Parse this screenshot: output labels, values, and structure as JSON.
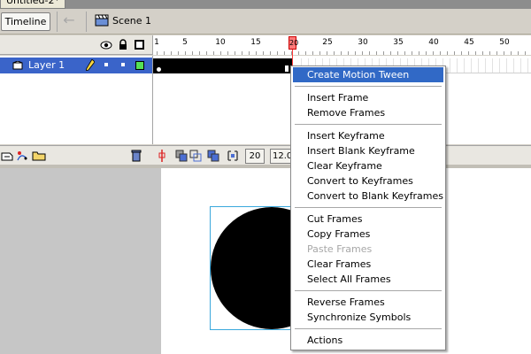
{
  "document": {
    "tab_title": "Untitled-2*"
  },
  "toolbar": {
    "timeline_label": "Timeline",
    "scene_label": "Scene 1"
  },
  "timeline": {
    "ruler_labels": [
      "1",
      "5",
      "10",
      "15",
      "20",
      "25",
      "30",
      "35",
      "40",
      "45",
      "50"
    ],
    "playhead_frame": "20",
    "layer": {
      "name": "Layer 1",
      "color": "#55e055"
    },
    "current_frame": "20",
    "frame_rate": "12.0"
  },
  "context_menu": {
    "items": [
      {
        "label": "Create Motion Tween",
        "state": "highlighted"
      },
      {
        "label": "Insert Frame",
        "state": "normal"
      },
      {
        "label": "Remove Frames",
        "state": "normal"
      },
      {
        "label": "Insert Keyframe",
        "state": "normal"
      },
      {
        "label": "Insert Blank Keyframe",
        "state": "normal"
      },
      {
        "label": "Clear Keyframe",
        "state": "normal"
      },
      {
        "label": "Convert to Keyframes",
        "state": "normal"
      },
      {
        "label": "Convert to Blank Keyframes",
        "state": "normal"
      },
      {
        "label": "Cut Frames",
        "state": "normal"
      },
      {
        "label": "Copy Frames",
        "state": "normal"
      },
      {
        "label": "Paste Frames",
        "state": "disabled"
      },
      {
        "label": "Clear Frames",
        "state": "normal"
      },
      {
        "label": "Select All Frames",
        "state": "normal"
      },
      {
        "label": "Reverse Frames",
        "state": "normal"
      },
      {
        "label": "Synchronize Symbols",
        "state": "normal"
      },
      {
        "label": "Actions",
        "state": "normal"
      }
    ]
  },
  "colors": {
    "selection": "#3169c6",
    "layer_highlight": "#3a64c9",
    "playhead": "#ff3b3b",
    "bbox": "#3aa8dc"
  }
}
